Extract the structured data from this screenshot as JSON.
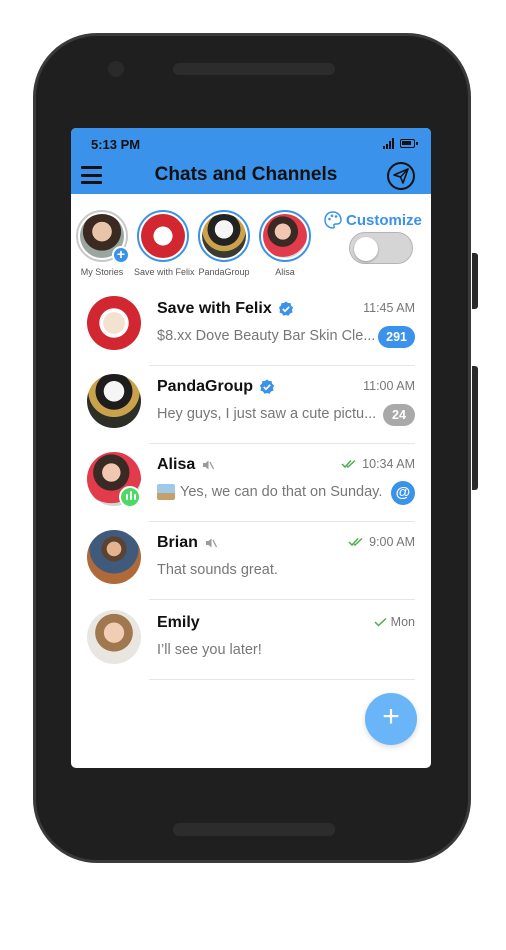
{
  "status_bar": {
    "time": "5:13 PM"
  },
  "header": {
    "title": "Chats and Channels"
  },
  "stories": [
    {
      "label": "My Stories"
    },
    {
      "label": "Save with Felix"
    },
    {
      "label": "PandaGroup"
    },
    {
      "label": "Alisa"
    }
  ],
  "customize": {
    "label": "Customize",
    "toggle_on": false
  },
  "chats": [
    {
      "name": "Save with Felix",
      "time": "11:45 AM",
      "preview": "$8.xx Dove Beauty Bar Skin Cle...",
      "badge": "291",
      "verified": true
    },
    {
      "name": "PandaGroup",
      "time": "11:00 AM",
      "preview": "Hey guys, I just saw a cute pictu...",
      "badge": "24",
      "verified": true
    },
    {
      "name": "Alisa",
      "time": "10:34 AM",
      "preview": "Yes, we can do that on Sunday.",
      "badge": "@",
      "muted": true,
      "read": "double"
    },
    {
      "name": "Brian",
      "time": "9:00 AM",
      "preview": "That sounds great.",
      "muted": true,
      "read": "double"
    },
    {
      "name": "Emily",
      "time": "Mon",
      "preview": "I’ll see you later!",
      "read": "single"
    }
  ],
  "colors": {
    "accent": "#3a92ea",
    "fab": "#6ab5f8",
    "read_check": "#4caf50",
    "gray_badge": "#a9a9a9"
  }
}
